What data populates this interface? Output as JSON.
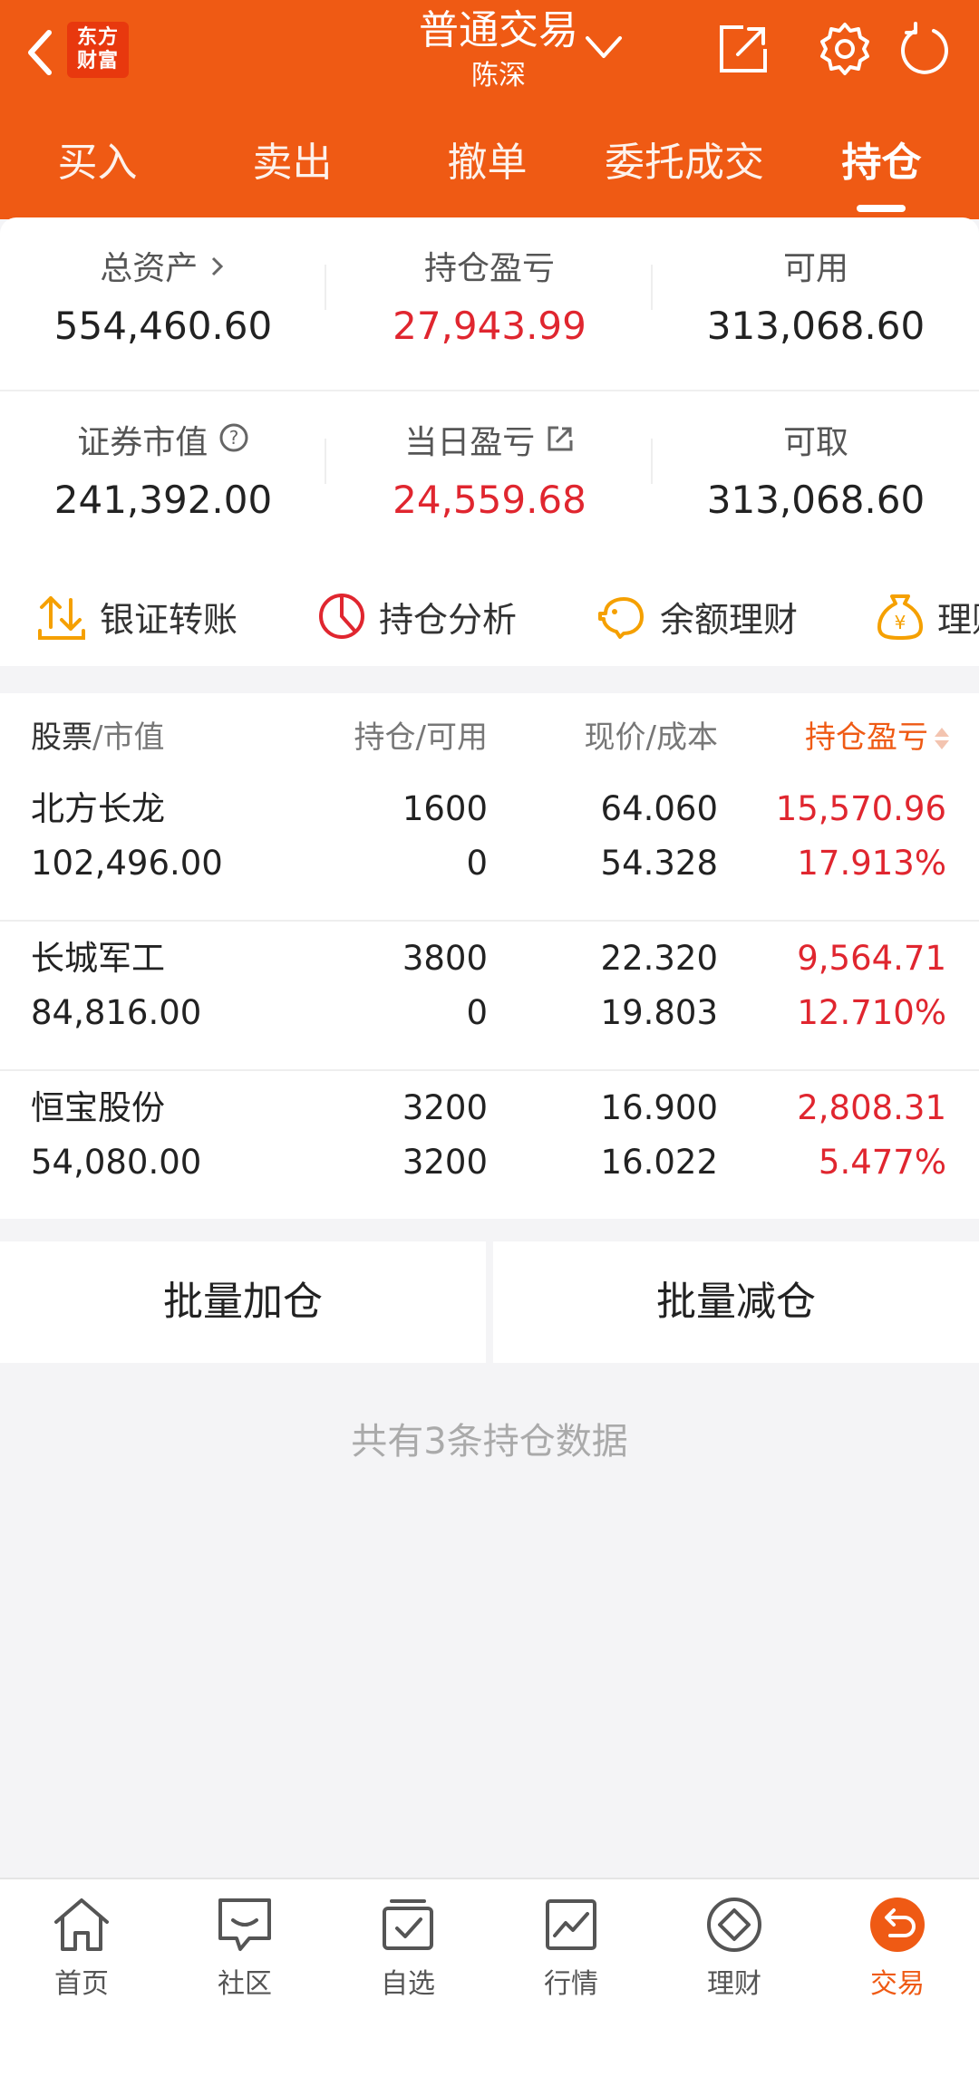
{
  "header": {
    "logo_line1": "东方",
    "logo_line2": "财富",
    "title": "普通交易",
    "subtitle": "陈深"
  },
  "tabs": [
    {
      "label": "买入"
    },
    {
      "label": "卖出"
    },
    {
      "label": "撤单"
    },
    {
      "label": "委托成交"
    },
    {
      "label": "持仓"
    }
  ],
  "summary": {
    "total_assets_label": "总资产",
    "total_assets_value": "554,460.60",
    "position_pl_label": "持仓盈亏",
    "position_pl_value": "27,943.99",
    "available_label": "可用",
    "available_value": "313,068.60",
    "market_value_label": "证券市值",
    "market_value_value": "241,392.00",
    "daily_pl_label": "当日盈亏",
    "daily_pl_value": "24,559.68",
    "withdrawable_label": "可取",
    "withdrawable_value": "313,068.60"
  },
  "actions": [
    {
      "label": "银证转账",
      "icon": "transfer-icon"
    },
    {
      "label": "持仓分析",
      "icon": "pie-chart-icon"
    },
    {
      "label": "余额理财",
      "icon": "piggy-bank-icon"
    },
    {
      "label": "理财",
      "icon": "money-bag-icon"
    }
  ],
  "holdings": {
    "headers": {
      "stock": "股票",
      "market_value": "/市值",
      "position": "持仓/可用",
      "price": "现价/成本",
      "pl": "持仓盈亏"
    },
    "rows": [
      {
        "name": "北方长龙",
        "market_value": "102,496.00",
        "position": "1600",
        "available": "0",
        "price": "64.060",
        "cost": "54.328",
        "pl": "15,570.96",
        "pl_pct": "17.913%"
      },
      {
        "name": "长城军工",
        "market_value": "84,816.00",
        "position": "3800",
        "available": "0",
        "price": "22.320",
        "cost": "19.803",
        "pl": "9,564.71",
        "pl_pct": "12.710%"
      },
      {
        "name": "恒宝股份",
        "market_value": "54,080.00",
        "position": "3200",
        "available": "3200",
        "price": "16.900",
        "cost": "16.022",
        "pl": "2,808.31",
        "pl_pct": "5.477%"
      }
    ]
  },
  "batch": {
    "add": "批量加仓",
    "reduce": "批量减仓"
  },
  "footer_note": "共有3条持仓数据",
  "bottom_nav": [
    {
      "label": "首页",
      "icon": "home-icon"
    },
    {
      "label": "社区",
      "icon": "chat-icon"
    },
    {
      "label": "自选",
      "icon": "watchlist-icon"
    },
    {
      "label": "行情",
      "icon": "market-chart-icon"
    },
    {
      "label": "理财",
      "icon": "diamond-icon"
    },
    {
      "label": "交易",
      "icon": "trade-icon",
      "active": true
    }
  ],
  "colors": {
    "brand": "#ef5a14",
    "profit_red": "#e0262f"
  }
}
